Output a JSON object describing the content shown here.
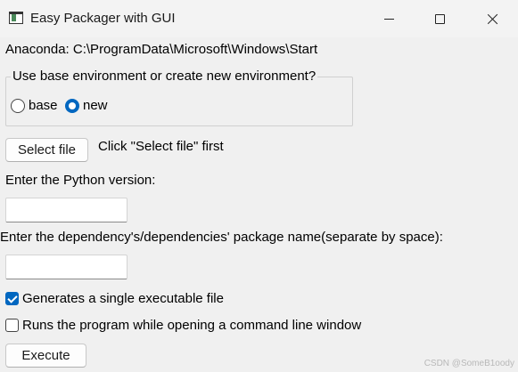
{
  "window": {
    "title": "Easy Packager with GUI",
    "icon": "app-window-icon"
  },
  "anaconda_label": "Anaconda: C:\\ProgramData\\Microsoft\\Windows\\Start",
  "environment_group": {
    "title": "Use base environment or create new environment?",
    "options": [
      {
        "label": "base",
        "selected": false
      },
      {
        "label": "new",
        "selected": true
      }
    ]
  },
  "select_file": {
    "button_label": "Select file",
    "status_text": "Click \"Select file\" first"
  },
  "python_version": {
    "label": "Enter the Python version:",
    "value": ""
  },
  "dependencies": {
    "label": "Enter the dependency's/dependencies' package name(separate by space):",
    "value": ""
  },
  "options": {
    "single_file": {
      "label": "Generates a single executable file",
      "checked": true
    },
    "console_window": {
      "label": "Runs the program while opening a command line window",
      "checked": false
    }
  },
  "execute_button_label": "Execute",
  "watermark": "CSDN @SomeB1oody",
  "colors": {
    "accent": "#0067c0",
    "background": "#f0f0f0"
  }
}
